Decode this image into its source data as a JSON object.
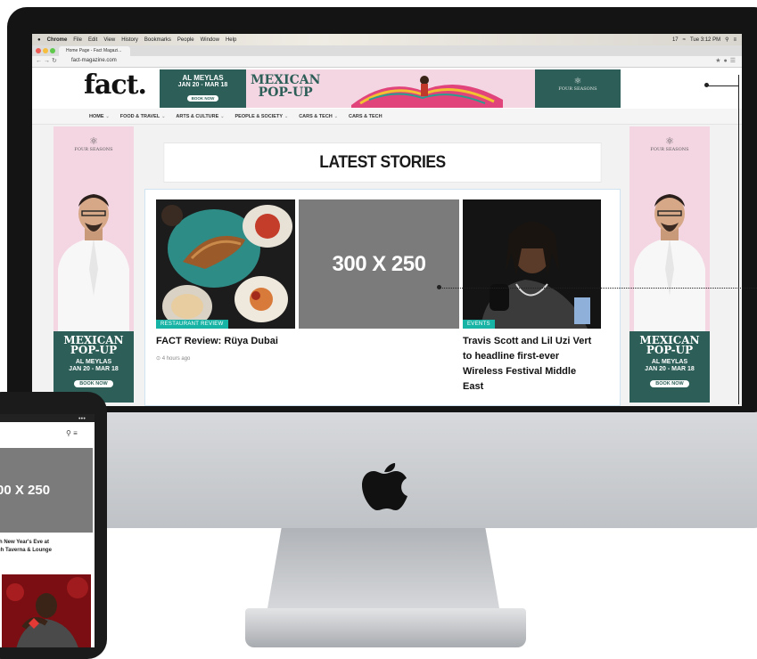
{
  "mac_menubar": {
    "apple": "",
    "app": "Chrome",
    "menus": [
      "File",
      "Edit",
      "View",
      "History",
      "Bookmarks",
      "People",
      "Window",
      "Help"
    ],
    "status_items": [
      "17",
      "Tue 3:12 PM"
    ]
  },
  "browser": {
    "tab_title": "Home Page - Fact Magazi...",
    "url": "fact-magazine.com"
  },
  "site": {
    "logo": "fact.",
    "nav": [
      "HOME",
      "FOOD & TRAVEL",
      "ARTS & CULTURE",
      "PEOPLE & SOCIETY",
      "CARS & TECH",
      "CARS & TECH"
    ],
    "section_title": "LATEST STORIES"
  },
  "banner_ad": {
    "venue": "AL MEYLAS",
    "dates": "JAN 20 - MAR 18",
    "cta": "BOOK NOW",
    "title_line1": "MEXICAN",
    "title_line2": "POP-UP",
    "brand": "FOUR SEASONS"
  },
  "side_ad": {
    "brand": "FOUR SEASONS",
    "title_line1": "MEXICAN",
    "title_line2": "POP-UP",
    "venue": "AL MEYLAS",
    "dates": "JAN 20 - MAR 18",
    "cta": "BOOK NOW"
  },
  "stories": [
    {
      "tag": "RESTAURANT REVIEW",
      "title": "FACT Review: Rüya Dubai",
      "time": "⊙ 4 hours ago"
    },
    {
      "tag": "EVENTS",
      "title": "Travis Scott and Lil Uzi Vert to headline first-ever Wireless Festival Middle East"
    }
  ],
  "ad_placeholder": "300 X 250",
  "phone": {
    "ad_placeholder": "00 X 250",
    "title_line1": "ish New Year's Eve at",
    "title_line2": "ach Taverna & Lounge"
  },
  "colors": {
    "accent_teal": "#17b4a6",
    "ad_green": "#2d5f58",
    "ad_pink": "#f4d6e2",
    "placeholder_gray": "#7b7b7b"
  }
}
